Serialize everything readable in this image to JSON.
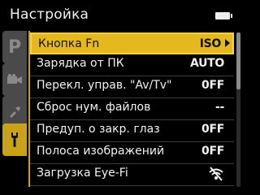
{
  "header": {
    "title": "Настройка",
    "battery_icon": "battery-full-icon"
  },
  "tabs": [
    {
      "name": "playback-tab",
      "glyph": "P",
      "active": false
    },
    {
      "name": "movie-tab",
      "icon": "movie-camera-icon",
      "active": false
    },
    {
      "name": "retouch-tab",
      "icon": "retouch-icon",
      "active": false
    },
    {
      "name": "setup-tab",
      "icon": "wrench-icon",
      "active": true
    }
  ],
  "menu": {
    "items": [
      {
        "label": "Кнопка Fn",
        "value": "ISO",
        "selected": true
      },
      {
        "label": "Зарядка от ПК",
        "value": "AUTO",
        "selected": false
      },
      {
        "label": "Перекл. управ. \"Av/Tv\"",
        "value": "0FF",
        "selected": false
      },
      {
        "label": "Сброс нум. файлов",
        "value": "--",
        "selected": false
      },
      {
        "label": "Предуп. о закр. глаз",
        "value": "0FF",
        "selected": false
      },
      {
        "label": "Полоса изображений",
        "value": "0FF",
        "selected": false
      },
      {
        "label": "Загрузка Eye-Fi",
        "value": "",
        "icon": "eye-fi-disabled-icon",
        "selected": false
      }
    ]
  },
  "colors": {
    "accent": "#e6b820",
    "tab_inactive": "#4a4a4a",
    "background": "#000000"
  }
}
